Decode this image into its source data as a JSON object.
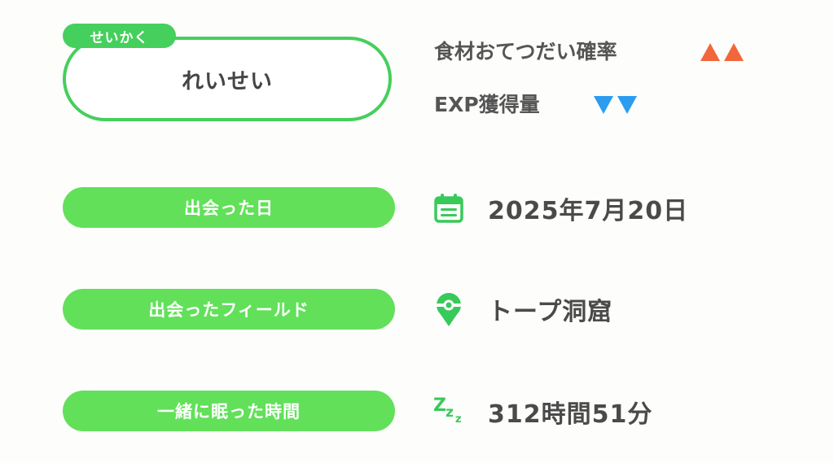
{
  "nature": {
    "label": "せいかく",
    "value": "れいせい"
  },
  "nature_effects": [
    {
      "label": "食材おてつだい確率",
      "direction": "up",
      "count": 2,
      "color": "#f2663b"
    },
    {
      "label": "EXP獲得量",
      "direction": "down",
      "count": 2,
      "color": "#2b9cf0"
    }
  ],
  "info": {
    "met_date_label": "出会った日",
    "met_date_value": "2025年7月20日",
    "met_field_label": "出会ったフィールド",
    "met_field_value": "トープ洞窟",
    "sleep_time_label": "一緒に眠った時間",
    "sleep_time_value": "312時間51分"
  },
  "icons": {
    "date": "calendar-icon",
    "field": "location-pin-icon",
    "sleep": "zzz-sleep-icon"
  },
  "colors": {
    "accent_green": "#45cf5c",
    "pill_green": "#62e05a",
    "up_arrow": "#f2663b",
    "down_arrow": "#2b9cf0"
  }
}
